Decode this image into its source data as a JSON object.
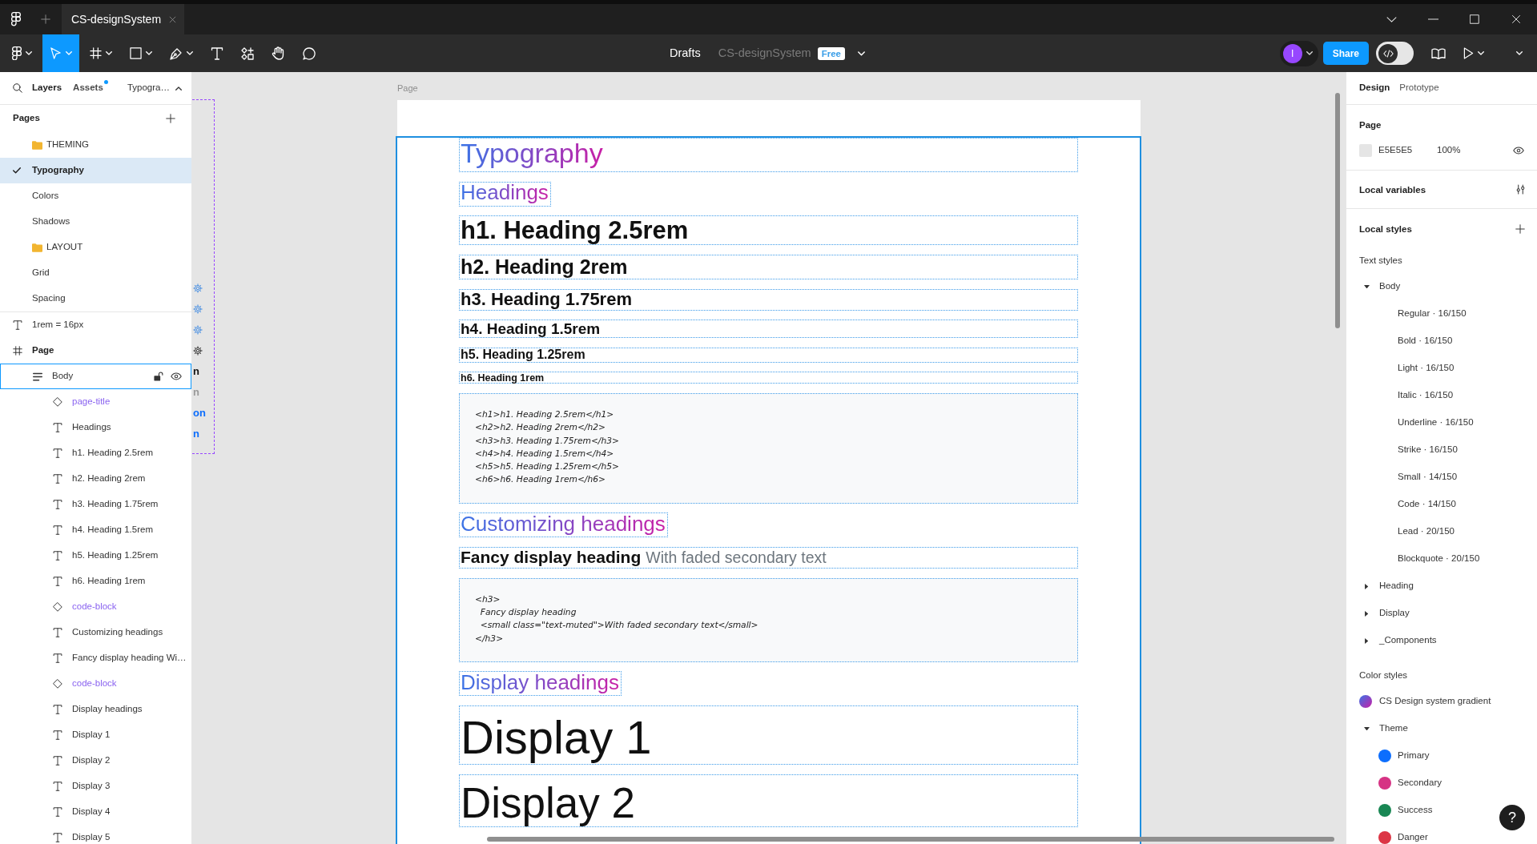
{
  "title_bar": {
    "tabs": [
      {
        "label": "CS-designSystem",
        "selected": true
      }
    ]
  },
  "toolbar": {
    "tools": [
      {
        "kind": "main-menu",
        "selected": false,
        "caret": true
      },
      {
        "kind": "move",
        "selected": true,
        "caret": true
      },
      {
        "kind": "frame",
        "selected": false,
        "caret": true
      },
      {
        "kind": "rectangle",
        "selected": false,
        "caret": true
      },
      {
        "kind": "pen",
        "selected": false,
        "caret": true
      },
      {
        "kind": "text",
        "selected": false,
        "caret": false
      },
      {
        "kind": "actions",
        "selected": false,
        "caret": false
      },
      {
        "kind": "hand",
        "selected": false,
        "caret": false
      },
      {
        "kind": "comment",
        "selected": false,
        "caret": false
      }
    ],
    "location": "Drafts",
    "file_name": "CS-designSystem",
    "plan": "Free",
    "avatar": "I",
    "share": "Share",
    "dev_mode": false
  },
  "left_panel": {
    "tabs": [
      {
        "label": "Layers",
        "selected": true,
        "dot": false
      },
      {
        "label": "Assets",
        "selected": false,
        "dot": true
      }
    ],
    "page_menu": "Typogra…",
    "pages": {
      "title": "Pages",
      "items": [
        {
          "label": "THEMING",
          "kind": "folder",
          "selected": false
        },
        {
          "label": "Typography",
          "kind": "page",
          "selected": true
        },
        {
          "label": "Colors",
          "kind": "page",
          "selected": false
        },
        {
          "label": "Shadows",
          "kind": "page",
          "selected": false
        },
        {
          "label": "LAYOUT",
          "kind": "folder",
          "selected": false
        },
        {
          "label": "Grid",
          "kind": "page",
          "selected": false
        },
        {
          "label": "Spacing",
          "kind": "page",
          "selected": false
        }
      ]
    },
    "layers": [
      {
        "label": "1rem = 16px",
        "kind": "text",
        "selected": false
      },
      {
        "label": "Page",
        "kind": "frame",
        "selected": false,
        "children": [
          {
            "label": "Body",
            "kind": "stack",
            "selected": true,
            "children": [
              {
                "label": "page-title",
                "kind": "instance",
                "selected": false
              },
              {
                "label": "Headings",
                "kind": "text",
                "selected": false
              },
              {
                "label": "h1. Heading 2.5rem",
                "kind": "text",
                "selected": false
              },
              {
                "label": "h2. Heading 2rem",
                "kind": "text",
                "selected": false
              },
              {
                "label": "h3. Heading 1.75rem",
                "kind": "text",
                "selected": false
              },
              {
                "label": "h4. Heading 1.5rem",
                "kind": "text",
                "selected": false
              },
              {
                "label": "h5. Heading 1.25rem",
                "kind": "text",
                "selected": false
              },
              {
                "label": "h6. Heading 1rem",
                "kind": "text",
                "selected": false
              },
              {
                "label": "code-block",
                "kind": "instance",
                "selected": false
              },
              {
                "label": "Customizing headings",
                "kind": "text",
                "selected": false
              },
              {
                "label": "Fancy display heading Wi…",
                "kind": "text",
                "selected": false
              },
              {
                "label": "code-block",
                "kind": "instance",
                "selected": false
              },
              {
                "label": "Display headings",
                "kind": "text",
                "selected": false
              },
              {
                "label": "Display 1",
                "kind": "text",
                "selected": false
              },
              {
                "label": "Display 2",
                "kind": "text",
                "selected": false
              },
              {
                "label": "Display 3",
                "kind": "text",
                "selected": false
              },
              {
                "label": "Display 4",
                "kind": "text",
                "selected": false
              },
              {
                "label": "Display 5",
                "kind": "text",
                "selected": false
              }
            ]
          }
        ]
      }
    ]
  },
  "canvas": {
    "page_label": "Page",
    "side_frame": {
      "items": [
        {
          "kind": "gear",
          "color": "#4a90e2"
        },
        {
          "kind": "gear",
          "color": "#4a90e2"
        },
        {
          "kind": "gear",
          "color": "#4a90e2"
        },
        {
          "kind": "gear",
          "color": "#333333"
        },
        {
          "kind": "text",
          "text": "n",
          "color": "#111111"
        },
        {
          "kind": "text",
          "text": "n",
          "color": "#9a9a9a"
        },
        {
          "kind": "text",
          "text": "on",
          "color": "#0d6efd"
        },
        {
          "kind": "text",
          "text": "n",
          "color": "#0d6efd"
        }
      ]
    },
    "blocks": [
      {
        "kind": "title",
        "text": "Typography"
      },
      {
        "kind": "section",
        "text": "Headings"
      },
      {
        "kind": "h1",
        "text": "h1. Heading 2.5rem"
      },
      {
        "kind": "h2",
        "text": "h2. Heading 2rem"
      },
      {
        "kind": "h3",
        "text": "h3. Heading 1.75rem"
      },
      {
        "kind": "h4",
        "text": "h4. Heading 1.5rem"
      },
      {
        "kind": "h5",
        "text": "h5. Heading 1.25rem"
      },
      {
        "kind": "h6",
        "text": "h6. Heading 1rem"
      },
      {
        "kind": "code",
        "lines": [
          "<h1>h1. Heading 2.5rem</h1>",
          "<h2>h2. Heading 2rem</h2>",
          "<h3>h3. Heading 1.75rem</h3>",
          "<h4>h4. Heading 1.5rem</h4>",
          "<h5>h5. Heading 1.25rem</h5>",
          "<h6>h6. Heading 1rem</h6>"
        ]
      },
      {
        "kind": "section",
        "text": "Customizing headings"
      },
      {
        "kind": "fancy",
        "text": "Fancy display heading",
        "muted": "With faded secondary text"
      },
      {
        "kind": "code",
        "lines": [
          "<h3>",
          "  Fancy display heading",
          "  <small class=\"text-muted\">With faded secondary text</small>",
          "</h3>"
        ]
      },
      {
        "kind": "section",
        "text": "Display headings"
      },
      {
        "kind": "display1",
        "text": "Display 1"
      },
      {
        "kind": "display2",
        "text": "Display 2"
      }
    ]
  },
  "right_panel": {
    "tabs": [
      {
        "label": "Design",
        "selected": true
      },
      {
        "label": "Prototype",
        "selected": false
      }
    ],
    "page": {
      "title": "Page",
      "fill": "E5E5E5",
      "opacity": "100%"
    },
    "variables_title": "Local variables",
    "styles_title": "Local styles",
    "text_styles": {
      "title": "Text styles",
      "groups": [
        {
          "label": "Body",
          "expanded": true,
          "children": [
            {
              "label": "Regular · 16/150"
            },
            {
              "label": "Bold · 16/150"
            },
            {
              "label": "Light · 16/150"
            },
            {
              "label": "Italic · 16/150"
            },
            {
              "label": "Underline · 16/150"
            },
            {
              "label": "Strike · 16/150"
            },
            {
              "label": "Small · 14/150"
            },
            {
              "label": "Code · 14/150"
            },
            {
              "label": "Lead · 20/150"
            },
            {
              "label": "Blockquote · 20/150"
            }
          ]
        },
        {
          "label": "Heading",
          "expanded": false
        },
        {
          "label": "Display",
          "expanded": false
        },
        {
          "label": "_Components",
          "expanded": false
        }
      ]
    },
    "color_styles": {
      "title": "Color styles",
      "items": [
        {
          "kind": "gradient",
          "label": "CS Design system gradient"
        },
        {
          "kind": "group",
          "label": "Theme",
          "expanded": true,
          "children": [
            {
              "label": "Primary",
              "color": "#0d6efd"
            },
            {
              "label": "Secondary",
              "color": "#d63384"
            },
            {
              "label": "Success",
              "color": "#198754"
            },
            {
              "label": "Danger",
              "color": "#dc3545"
            }
          ]
        }
      ]
    },
    "help": "?"
  }
}
